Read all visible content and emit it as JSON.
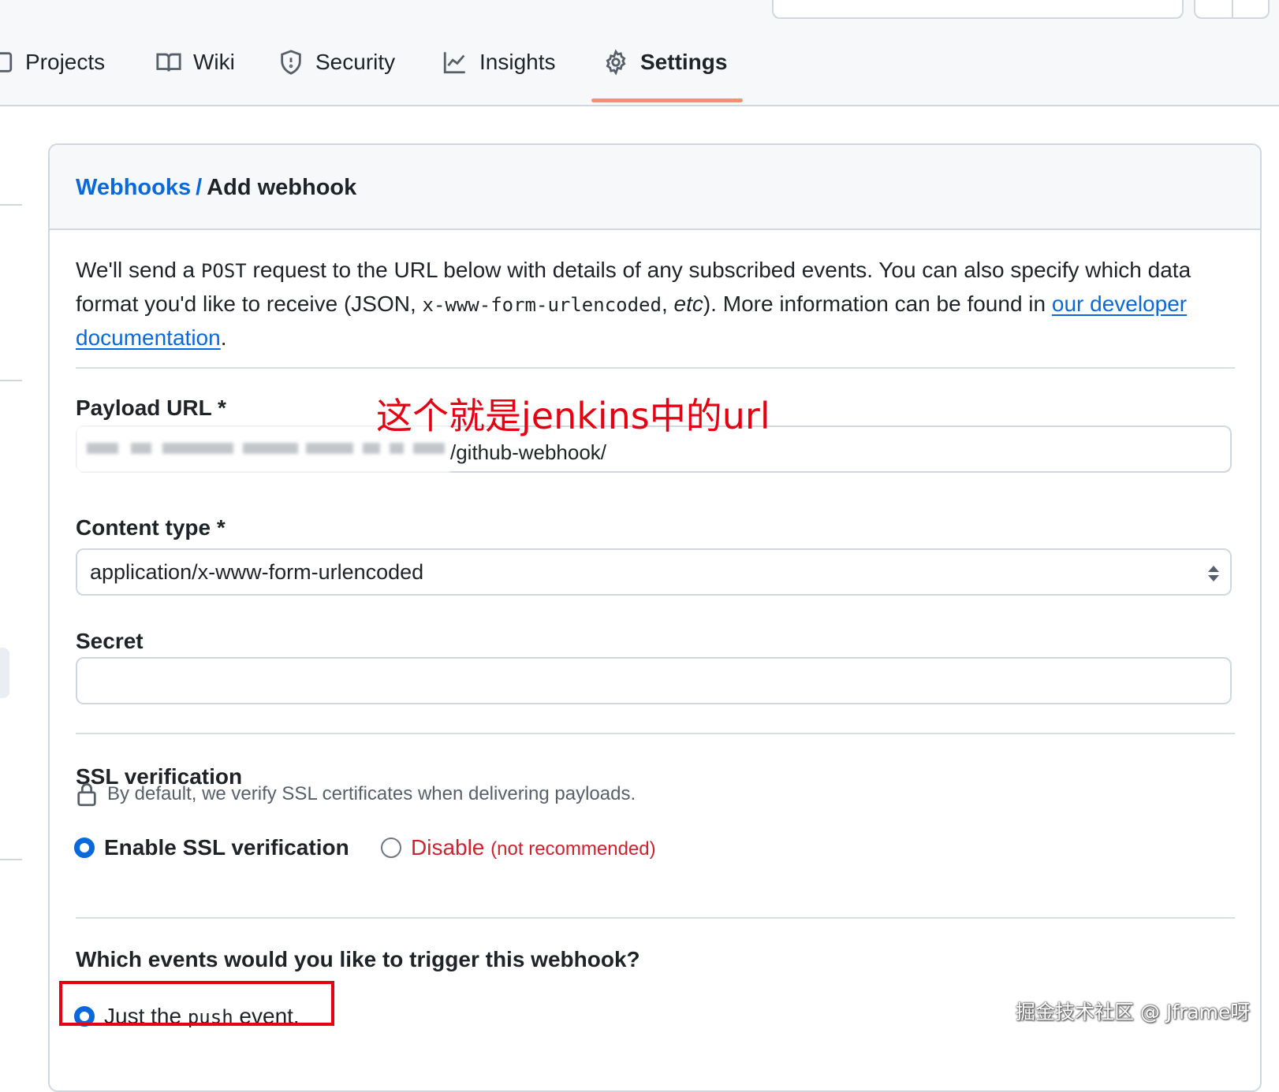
{
  "nav": {
    "tabs": [
      {
        "label": "Projects",
        "icon": "table-icon"
      },
      {
        "label": "Wiki",
        "icon": "book-icon"
      },
      {
        "label": "Security",
        "icon": "shield-icon"
      },
      {
        "label": "Insights",
        "icon": "graph-icon"
      },
      {
        "label": "Settings",
        "icon": "gear-icon",
        "selected": true
      }
    ]
  },
  "breadcrumb": {
    "parent": "Webhooks",
    "separator": "/",
    "current": "Add webhook"
  },
  "intro": {
    "part1": "We'll send a ",
    "method": "POST",
    "part2": " request to the URL below with details of any subscribed events. You can also specify which data format you'd like to receive (JSON, ",
    "format_code": "x-www-form-urlencoded",
    "part3": ", ",
    "etc": "etc",
    "part4": "). More information can be found in ",
    "link_text": "our developer documentation",
    "part5": "."
  },
  "payload_url": {
    "label": "Payload URL *",
    "value_visible_suffix": "/github-webhook/"
  },
  "content_type": {
    "label": "Content type *",
    "value": "application/x-www-form-urlencoded"
  },
  "secret": {
    "label": "Secret",
    "value": ""
  },
  "ssl": {
    "heading": "SSL verification",
    "note": "By default, we verify SSL certificates when delivering payloads.",
    "enable_label": "Enable SSL verification",
    "disable_label": "Disable",
    "disable_hint": "(not recommended)"
  },
  "events": {
    "question": "Which events would you like to trigger this webhook?",
    "just_push": {
      "pre": "Just the ",
      "code": "push",
      "post": " event."
    }
  },
  "annotation": {
    "text": "这个就是jenkins中的url",
    "color": "#e60012"
  },
  "watermark": "掘金技术社区 @ Jframe呀",
  "colors": {
    "accent": "#0969da",
    "danger": "#cf222e",
    "tab_underline": "#fd8c73",
    "border": "#d0d7de"
  }
}
